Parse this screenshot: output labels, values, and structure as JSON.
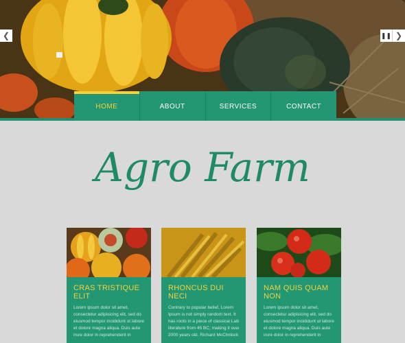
{
  "hero": {
    "arrow_left": "❮",
    "arrow_right": "❯",
    "pause": "❚❚"
  },
  "nav": {
    "items": [
      "HOME",
      "ABOUT",
      "SERVICES",
      "CONTACT"
    ],
    "active_color": "#f5d23a",
    "bg_color": "#239673"
  },
  "site_title": "Agro Farm",
  "cards": [
    {
      "title_line1": "CRAS TRISTIQUE",
      "title_line2": "ELIT",
      "text": [
        "Lorem ipsum dolor sit amet,",
        "consectetur adipisicing elit, sed do",
        "eiusmod tempor incididunt ut labore",
        "et dolore magna aliqua. Duis aute",
        "irure dolor in reprehenderit in"
      ]
    },
    {
      "title_line1": "RHONCUS DUI",
      "title_line2": "NECI",
      "text": [
        "Contrary to popular belief, Lorem",
        "Ipsum is not simply random text. It",
        "has roots in a piece of classical Latin",
        "literature from 45 BC, making it over",
        "2000 years old. Richard McClintock,"
      ]
    },
    {
      "title_line1": "NAM QUIS QUAM",
      "title_line2": "NON",
      "text": [
        "Lorem ipsum dolor sit amet,",
        "consectetur adipisicing elit, sed do",
        "eiusmod tempor incididunt ut labore",
        "et dolore magna aliqua. Duis aute",
        "irure dolor in reprehenderit in"
      ]
    }
  ]
}
